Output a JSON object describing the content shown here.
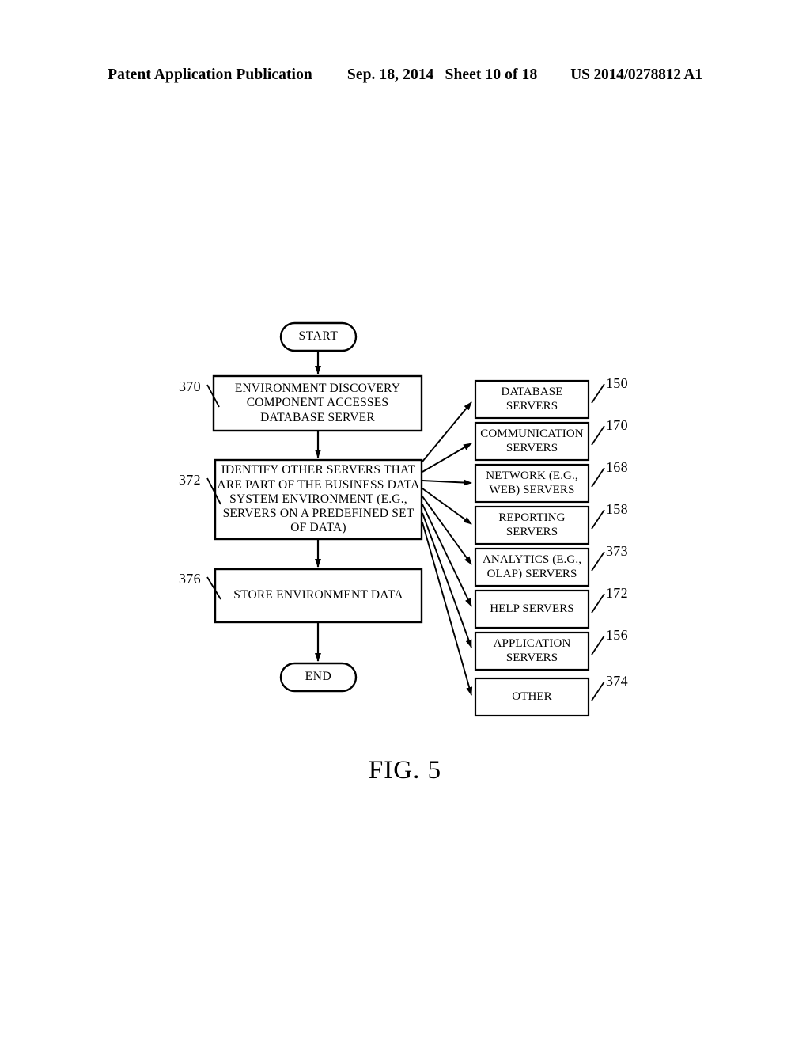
{
  "header": {
    "publication": "Patent Application Publication",
    "date": "Sep. 18, 2014",
    "sheet": "Sheet 10 of 18",
    "number": "US 2014/0278812 A1"
  },
  "figure": {
    "caption": "FIG. 5"
  },
  "flowchart": {
    "start": {
      "label": "START"
    },
    "end": {
      "label": "END"
    },
    "steps": [
      {
        "ref": "370",
        "lines": [
          "ENVIRONMENT DISCOVERY",
          "COMPONENT ACCESSES",
          "DATABASE SERVER"
        ]
      },
      {
        "ref": "372",
        "lines": [
          "IDENTIFY OTHER SERVERS THAT",
          "ARE PART OF THE BUSINESS DATA",
          "SYSTEM ENVIRONMENT (E.G.,",
          "SERVERS ON A PREDEFINED SET",
          "OF DATA)"
        ]
      },
      {
        "ref": "376",
        "lines": [
          "STORE ENVIRONMENT DATA"
        ]
      }
    ]
  },
  "servers": [
    {
      "ref": "150",
      "lines": [
        "DATABASE",
        "SERVERS"
      ]
    },
    {
      "ref": "170",
      "lines": [
        "COMMUNICATION",
        "SERVERS"
      ]
    },
    {
      "ref": "168",
      "lines": [
        "NETWORK (E.G.,",
        "WEB) SERVERS"
      ]
    },
    {
      "ref": "158",
      "lines": [
        "REPORTING",
        "SERVERS"
      ]
    },
    {
      "ref": "373",
      "lines": [
        "ANALYTICS (E.G.,",
        "OLAP) SERVERS"
      ]
    },
    {
      "ref": "172",
      "lines": [
        "HELP SERVERS"
      ]
    },
    {
      "ref": "156",
      "lines": [
        "APPLICATION",
        "SERVERS"
      ]
    },
    {
      "ref": "374",
      "lines": [
        "OTHER"
      ]
    }
  ],
  "style": {
    "ink": "#000000",
    "paper": "#ffffff"
  }
}
